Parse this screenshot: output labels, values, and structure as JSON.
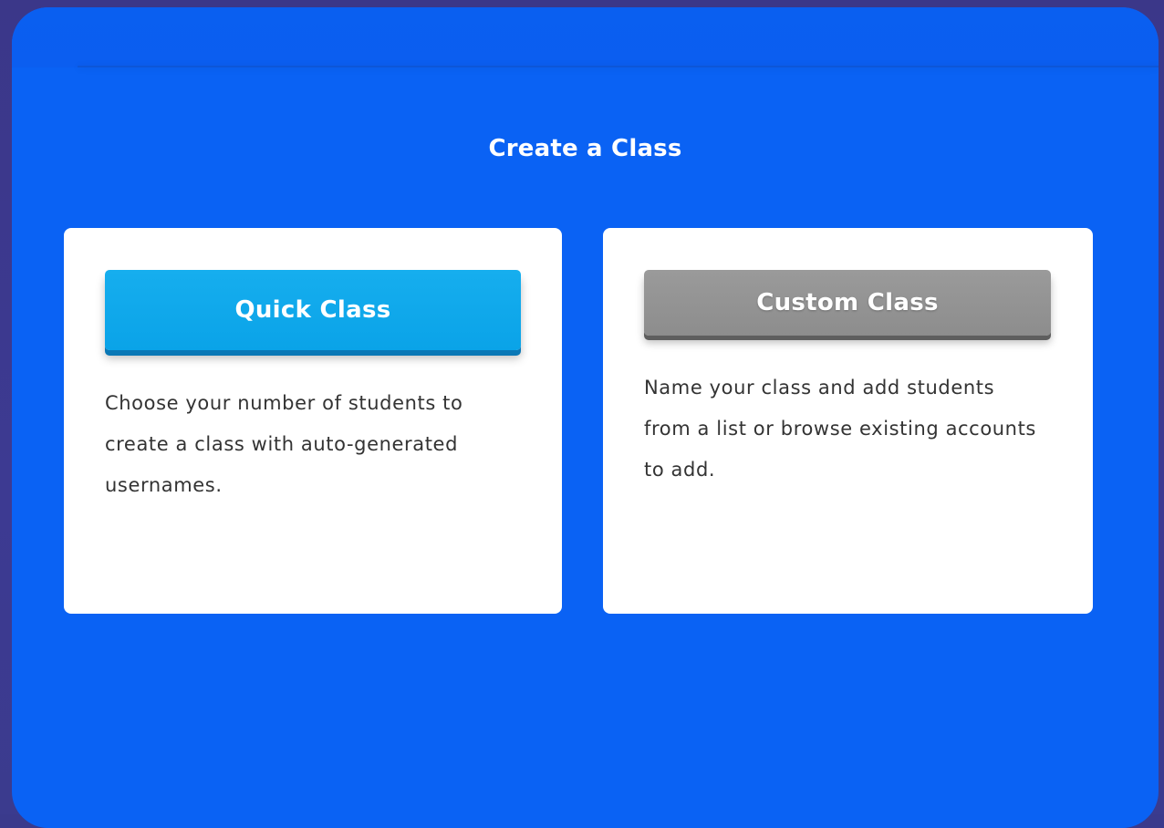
{
  "dialog": {
    "title": "Create a Class"
  },
  "options": [
    {
      "button_label": "Quick Class",
      "description": "Choose your number of students to create a class with auto-generated usernames.",
      "button_color": "#0aa3e8"
    },
    {
      "button_label": "Custom Class",
      "description": "Name your class and add students from a list or browse existing accounts to add.",
      "button_color": "#8d8d8d"
    }
  ],
  "colors": {
    "panel_background": "#0a62f4",
    "outer_background": "#3b3789",
    "card_background": "#ffffff",
    "description_text": "#333333"
  }
}
